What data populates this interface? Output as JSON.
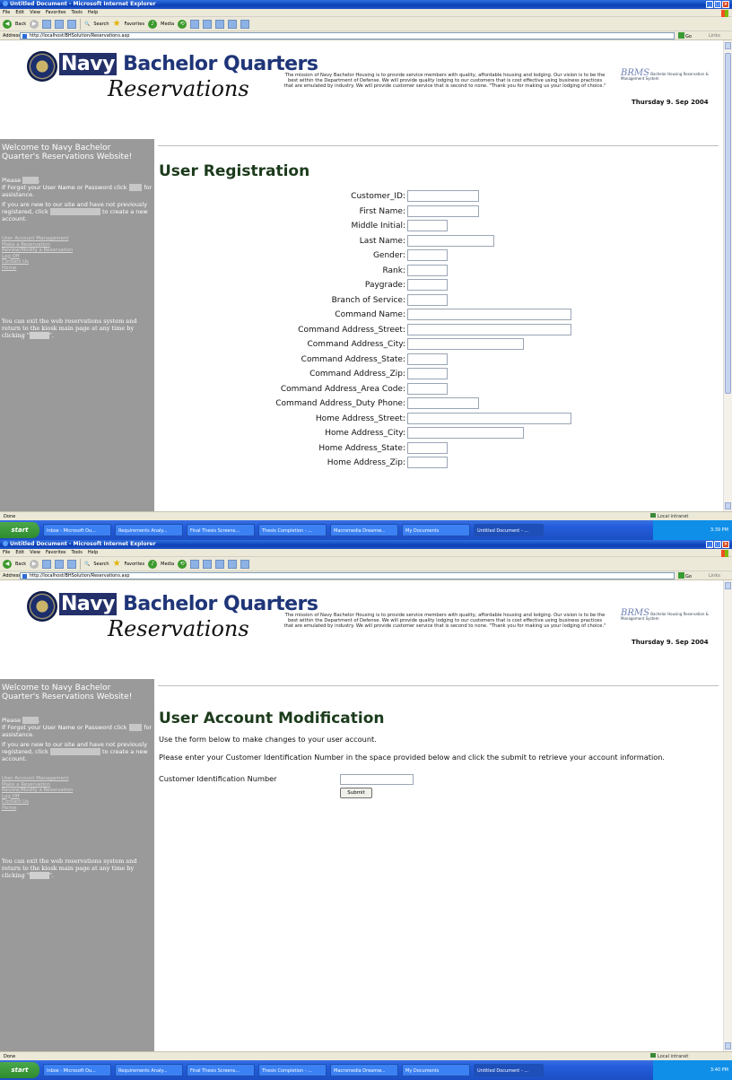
{
  "browser": {
    "title": "Untitled Document - Microsoft Internet Explorer",
    "menu": [
      "File",
      "Edit",
      "View",
      "Favorites",
      "Tools",
      "Help"
    ],
    "toolbar": {
      "back": "Back",
      "search": "Search",
      "favorites": "Favorites",
      "media": "Media"
    },
    "address_label": "Address",
    "url": "http://localhost/BHSolution/Reservations.asp",
    "go_label": "Go",
    "links_label": "Links",
    "status_text": "Done",
    "zone_text": "Local intranet"
  },
  "taskbar": {
    "start_label": "start",
    "tasks": [
      "Inbox - Microsoft Ou...",
      "Requirements Analy...",
      "Final Thesis Screens...",
      "Thesis Completion - ...",
      "Macromedia Dreamw...",
      "My Documents",
      "Untitled Document - ..."
    ],
    "clock_1": "3:39 PM",
    "clock_2": "3:40 PM"
  },
  "banner": {
    "logo_navy": "Navy",
    "logo_bq": " Bachelor Quarters",
    "logo_reservations": "Reservations",
    "mission": "The mission of Navy Bachelor Housing is to provide service members with quality, affordable housing and lodging. Our vision is to be the best within the Department of Defense. We will provide quality lodging to our customers that is cost effective using business practices that are emulated by industry. We will provide customer service that is second to none. \"Thank you for making us your lodging of choice.\"",
    "mini_logo_big": "BRMS",
    "mini_logo_small": "Bachelor Housing Reservation & Management System",
    "date": "Thursday 9. Sep 2004"
  },
  "sidebar": {
    "welcome": "Welcome to Navy Bachelor Quarter's Reservations Website!",
    "please": "Please",
    "login_link": "Login",
    "forgot": "If Forgot your User Name or Password click",
    "forgot_link": "here",
    "assistance": "for assistance.",
    "new_user": "If you are new to our site and have not previously registered, click",
    "new_user_link": "User Registration",
    "create_account": "to create a new account.",
    "links": [
      "User Account Management",
      "Make a Reservation",
      "Review/Modify a Reservation",
      "Log Off",
      "Contact Us",
      "Home"
    ],
    "exit_text": "You can exit the web reservations system and return to the kiosk main page at any time by clicking \"",
    "exit_link": "KIOSK",
    "exit_end": "\"."
  },
  "registration": {
    "title": "User Registration",
    "fields": [
      {
        "label": "Customer_ID:"
      },
      {
        "label": "First Name:"
      },
      {
        "label": "Middle Initial:"
      },
      {
        "label": "Last Name:"
      },
      {
        "label": "Gender:"
      },
      {
        "label": "Rank:"
      },
      {
        "label": "Paygrade:"
      },
      {
        "label": "Branch of Service:"
      },
      {
        "label": "Command Name:"
      },
      {
        "label": "Command Address_Street:"
      },
      {
        "label": "Command Address_City:"
      },
      {
        "label": "Command Address_State:"
      },
      {
        "label": "Command Address_Zip:"
      },
      {
        "label": "Command Address_Area Code:"
      },
      {
        "label": "Command Address_Duty Phone:"
      },
      {
        "label": "Home Address_Street:"
      },
      {
        "label": "Home Address_City:"
      },
      {
        "label": "Home Address_State:"
      },
      {
        "label": "Home Address_Zip:"
      }
    ]
  },
  "modification": {
    "title": "User Account Modification",
    "intro": "Use the form below to make changes to your user account.",
    "instructions": "Please enter your Customer Identification Number in the space provided below and click the submit to retrieve your account information.",
    "cid_label": "Customer Identification Number",
    "submit_label": "Submit"
  }
}
